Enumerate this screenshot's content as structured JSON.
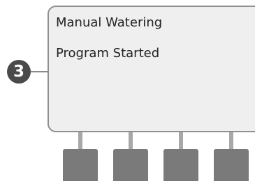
{
  "callout": {
    "number": "3"
  },
  "display": {
    "line1": "Manual Watering",
    "line2": "Program Started"
  },
  "soft_keys": {
    "count": 4
  },
  "colors": {
    "screen_background": "#efefef",
    "screen_border": "#8f8f8f",
    "button": "#7a7a7a",
    "badge": "#4a4a4a"
  }
}
